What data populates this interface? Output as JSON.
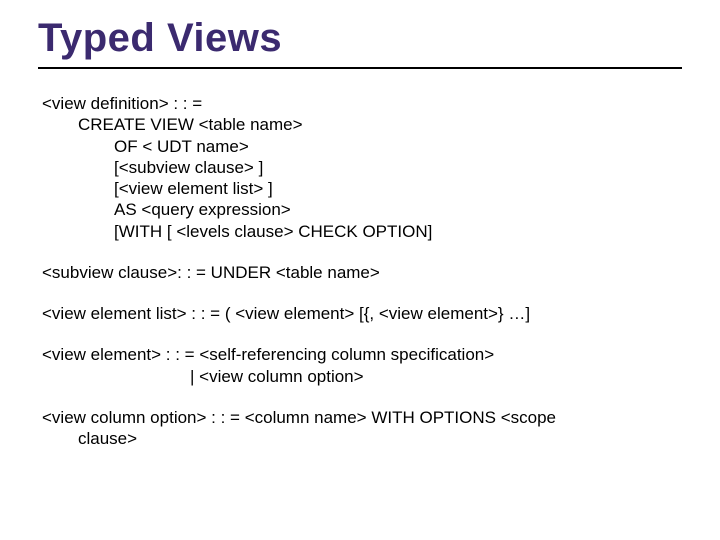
{
  "title": "Typed Views",
  "def": {
    "l1": "<view definition> : : =",
    "l2": "CREATE VIEW <table name>",
    "l3": "OF < UDT name>",
    "l4": "[<subview clause> ]",
    "l5": "[<view element list> ]",
    "l6": "AS <query expression>",
    "l7": "[WITH [ <levels clause> CHECK OPTION]"
  },
  "subview": "<subview clause>: : = UNDER <table name>",
  "elemlist": "<view element list> : : = ( <view element> [{, <view element>} …]",
  "elem": {
    "l1": "<view element> : : = <self-referencing column specification>",
    "l2": "| <view column option>"
  },
  "colopt": {
    "l1": "<view column option> : : = <column name> WITH OPTIONS <scope",
    "l2": "clause>"
  }
}
